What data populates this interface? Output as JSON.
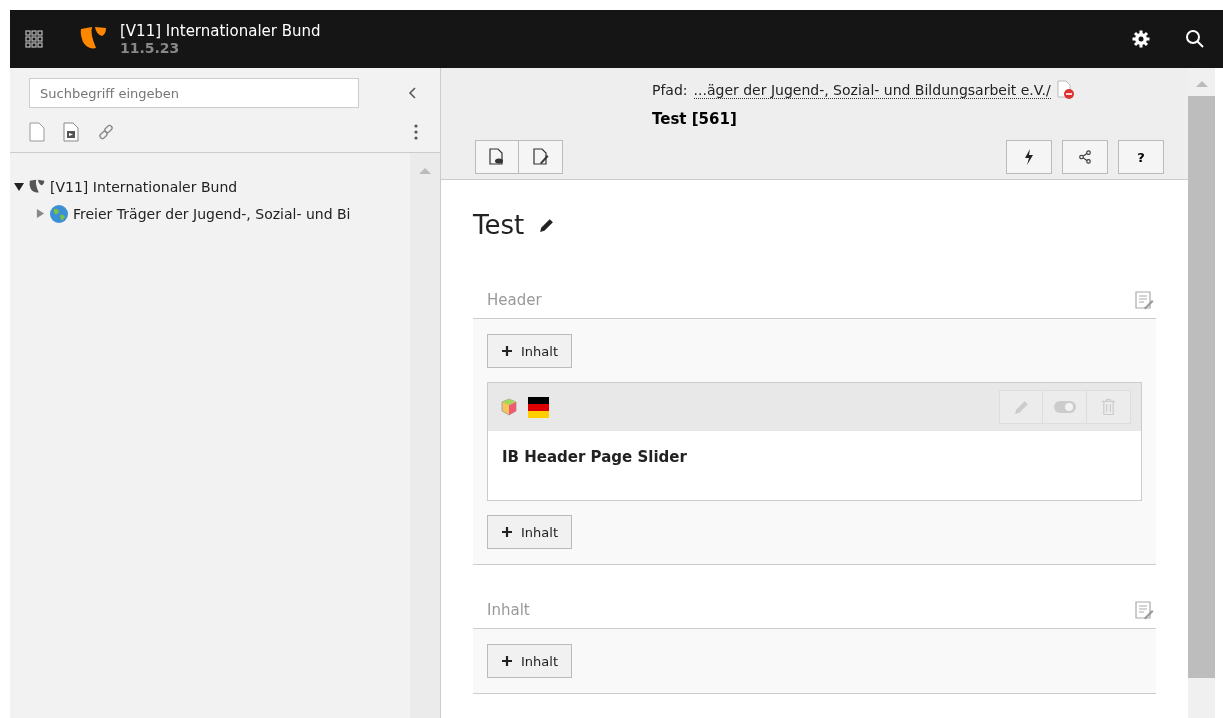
{
  "topbar": {
    "site_name": "[V11] Internationaler Bund",
    "version": "11.5.23"
  },
  "pagetree": {
    "search": {
      "placeholder": "Suchbegriff eingeben"
    },
    "nodes": [
      {
        "label": "[V11] Internationaler Bund",
        "kind": "root",
        "expanded": true,
        "children": [
          {
            "label": "Freier Träger der Jugend-, Sozial- und Bi",
            "kind": "site",
            "expanded": false
          }
        ]
      }
    ]
  },
  "docheader": {
    "path_label": "Pfad:",
    "path": "...äger der Jugend-, Sozial- und Bildungsarbeit e.V./",
    "page_title": "Test [561]",
    "help": "?"
  },
  "page": {
    "title": "Test",
    "columns": [
      {
        "label": "Header",
        "elements": [
          {
            "title": "IB Header Page Slider"
          }
        ],
        "add_buttons": [
          "Inhalt",
          "Inhalt"
        ]
      },
      {
        "label": "Inhalt",
        "add_buttons": [
          "Inhalt"
        ]
      }
    ]
  }
}
